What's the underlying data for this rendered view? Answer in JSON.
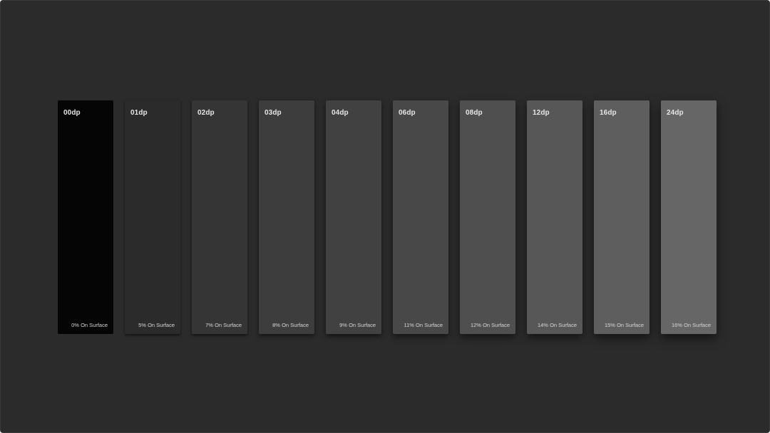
{
  "cards": [
    {
      "label": "00dp",
      "caption": "0% On Surface",
      "color": "#050505"
    },
    {
      "label": "01dp",
      "caption": "5% On Surface",
      "color": "#2b2b2b"
    },
    {
      "label": "02dp",
      "caption": "7% On Surface",
      "color": "#353535"
    },
    {
      "label": "03dp",
      "caption": "8% On Surface",
      "color": "#3d3d3d"
    },
    {
      "label": "04dp",
      "caption": "9% On Surface",
      "color": "#414141"
    },
    {
      "label": "06dp",
      "caption": "11% On Surface",
      "color": "#484848"
    },
    {
      "label": "08dp",
      "caption": "12% On Surface",
      "color": "#4f4f4f"
    },
    {
      "label": "12dp",
      "caption": "14% On Surface",
      "color": "#575757"
    },
    {
      "label": "16dp",
      "caption": "15% On Surface",
      "color": "#5e5e5e"
    },
    {
      "label": "24dp",
      "caption": "16% On Surface",
      "color": "#666666"
    }
  ],
  "background_color": "#2b2b2b"
}
